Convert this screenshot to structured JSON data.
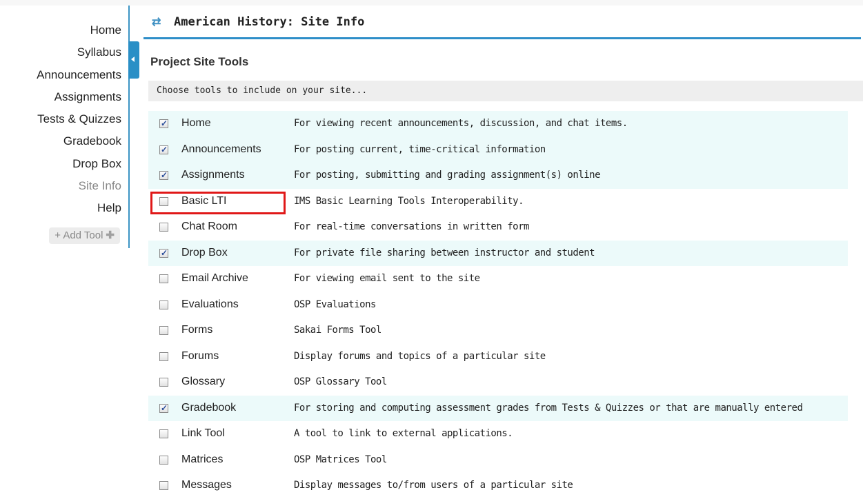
{
  "sidebar": {
    "items": [
      {
        "label": "Home"
      },
      {
        "label": "Syllabus"
      },
      {
        "label": "Announcements"
      },
      {
        "label": "Assignments"
      },
      {
        "label": "Tests & Quizzes"
      },
      {
        "label": "Gradebook"
      },
      {
        "label": "Drop Box"
      },
      {
        "label": "Site Info",
        "current": true
      },
      {
        "label": "Help"
      }
    ],
    "add_tool_label": "+ Add Tool"
  },
  "header": {
    "title": "American History: Site Info",
    "icon": "refresh-icon"
  },
  "section": {
    "title": "Project Site Tools",
    "instruction": "Choose tools to include on your site..."
  },
  "tools": [
    {
      "name": "Home",
      "description": "For viewing recent announcements, discussion, and chat items.",
      "checked": true
    },
    {
      "name": "Announcements",
      "description": "For posting current, time-critical information",
      "checked": true
    },
    {
      "name": "Assignments",
      "description": "For posting, submitting and grading assignment(s) online",
      "checked": true
    },
    {
      "name": "Basic LTI",
      "description": "IMS Basic Learning Tools Interoperability.",
      "checked": false
    },
    {
      "name": "Chat Room",
      "description": "For real-time conversations in written form",
      "checked": false
    },
    {
      "name": "Drop Box",
      "description": "For private file sharing between instructor and student",
      "checked": true
    },
    {
      "name": "Email Archive",
      "description": "For viewing email sent to the site",
      "checked": false
    },
    {
      "name": "Evaluations",
      "description": "OSP Evaluations",
      "checked": false
    },
    {
      "name": "Forms",
      "description": "Sakai Forms Tool",
      "checked": false
    },
    {
      "name": "Forums",
      "description": "Display forums and topics of a particular site",
      "checked": false
    },
    {
      "name": "Glossary",
      "description": "OSP Glossary Tool",
      "checked": false
    },
    {
      "name": "Gradebook",
      "description": "For storing and computing assessment grades from Tests & Quizzes or that are manually entered",
      "checked": true
    },
    {
      "name": "Link Tool",
      "description": "A tool to link to external applications.",
      "checked": false
    },
    {
      "name": "Matrices",
      "description": "OSP Matrices Tool",
      "checked": false
    },
    {
      "name": "Messages",
      "description": "Display messages to/from users of a particular site",
      "checked": false
    }
  ],
  "colors": {
    "accent": "#2e8ec8",
    "checked_row": "#ecfafa",
    "highlight": "#e01818"
  }
}
